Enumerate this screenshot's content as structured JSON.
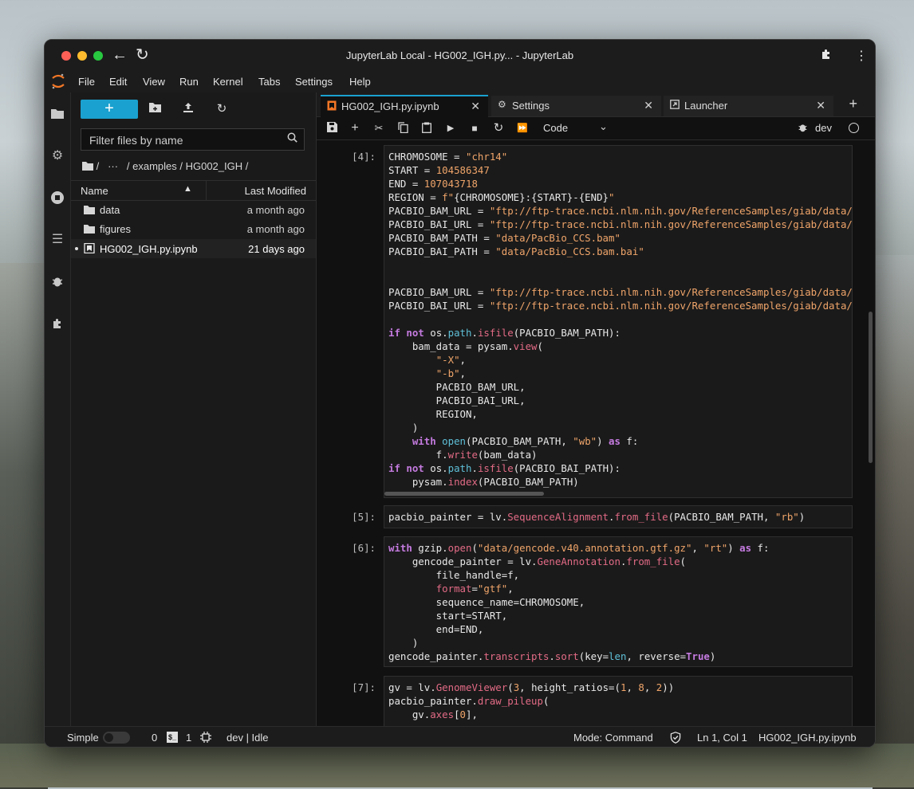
{
  "window": {
    "title": "JupyterLab Local - HG002_IGH.py... - JupyterLab"
  },
  "menu": [
    "File",
    "Edit",
    "View",
    "Run",
    "Kernel",
    "Tabs",
    "Settings",
    "Help"
  ],
  "filebrowser": {
    "new_label": "+",
    "filter_placeholder": "Filter files by name",
    "breadcrumb": "/   ···   / examples / HG002_IGH /",
    "col_name": "Name",
    "col_modified": "Last Modified",
    "rows": [
      {
        "name": "data",
        "modified": "a month ago",
        "type": "folder"
      },
      {
        "name": "figures",
        "modified": "a month ago",
        "type": "folder"
      },
      {
        "name": "HG002_IGH.py.ipynb",
        "modified": "21 days ago",
        "type": "notebook"
      }
    ]
  },
  "tabs": [
    {
      "label": "HG002_IGH.py.ipynb"
    },
    {
      "label": "Settings"
    },
    {
      "label": "Launcher"
    }
  ],
  "toolbar": {
    "cell_type": "Code",
    "kernel": "dev"
  },
  "cells": [
    {
      "prompt": "[4]:"
    },
    {
      "prompt": "[5]:"
    },
    {
      "prompt": "[6]:"
    },
    {
      "prompt": "[7]:"
    }
  ],
  "status": {
    "simple": "Simple",
    "count0": "0",
    "count1": "1",
    "kernel": "dev | Idle",
    "mode": "Mode: Command",
    "position": "Ln 1, Col 1",
    "file": "HG002_IGH.py.ipynb"
  },
  "colors": {
    "accent": "#1aa1cf",
    "background": "#111111",
    "string": "#f0a56a",
    "keyword": "#c57be0"
  }
}
